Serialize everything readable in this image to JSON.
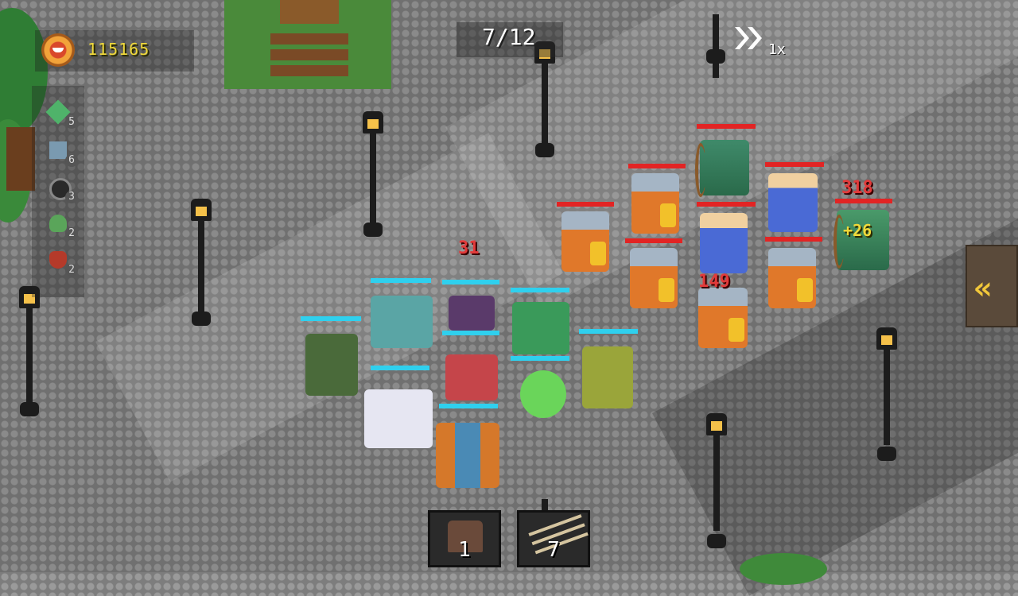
{
  "hud": {
    "gold_value": "115165",
    "gold_icon": "monster-coin-icon",
    "wave": "7/12",
    "speed_icon": "fast-forward-icon",
    "speed_label": "1x",
    "side_toggle_icon": "double-chevron-left-icon",
    "side_toggle_glyph": "«"
  },
  "inventory": {
    "items": [
      {
        "name": "green-gem-icon",
        "count": "5",
        "color": "#4fb36a"
      },
      {
        "name": "blue-shard-icon",
        "count": "6",
        "color": "#7a9ab0"
      },
      {
        "name": "dark-orb-icon",
        "count": "3",
        "color": "#2a2a2a"
      },
      {
        "name": "goblin-skull-icon",
        "count": "2",
        "color": "#5aa55a"
      },
      {
        "name": "demon-mask-icon",
        "count": "2",
        "color": "#b53a2a"
      }
    ]
  },
  "cards": [
    {
      "name": "armor-card",
      "icon": "chest-armor-icon",
      "count": "1"
    },
    {
      "name": "arrows-card",
      "icon": "arrow-bundle-icon",
      "count": "7"
    }
  ],
  "combat_text": {
    "dmg_a": "31",
    "dmg_b": "318",
    "dmg_c": "149",
    "heal_a": "+26"
  },
  "colors": {
    "ally_hp": "#2fd0ee",
    "enemy_hp": "#e22424",
    "gold": "#f0d93a"
  }
}
